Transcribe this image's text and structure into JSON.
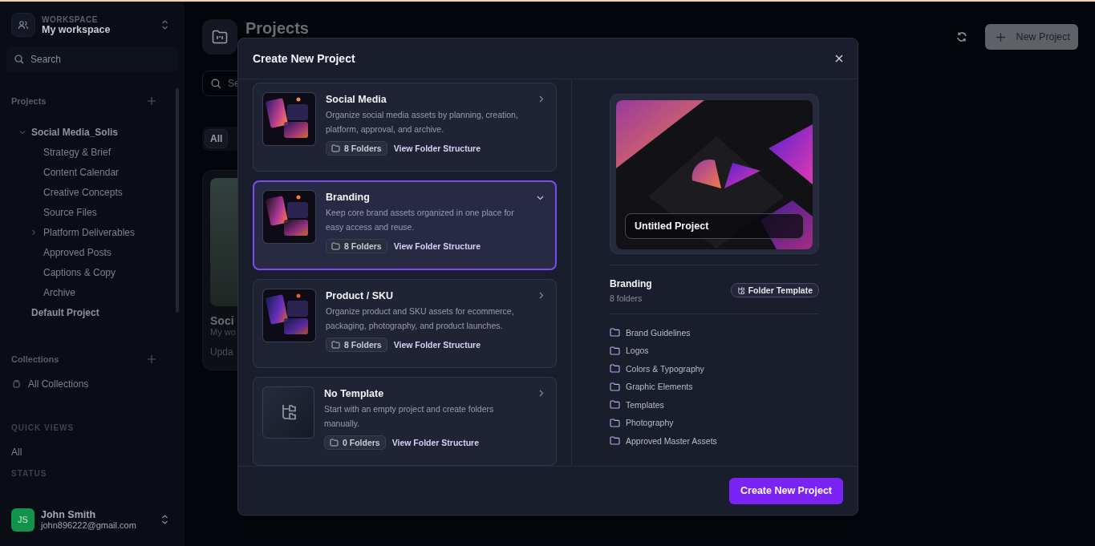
{
  "sidebar": {
    "workspace_label": "WORKSPACE",
    "workspace_name": "My workspace",
    "search": {
      "placeholder": "Search"
    },
    "projects_heading": "Projects",
    "projects": [
      {
        "label": "Social Media_Solis",
        "expanded": true,
        "children": [
          {
            "label": "Strategy & Brief"
          },
          {
            "label": "Content Calendar"
          },
          {
            "label": "Creative Concepts"
          },
          {
            "label": "Source Files"
          },
          {
            "label": "Platform Deliverables",
            "expanded": false
          },
          {
            "label": "Approved Posts"
          },
          {
            "label": "Captions & Copy"
          },
          {
            "label": "Archive"
          }
        ]
      },
      {
        "label": "Default Project"
      }
    ],
    "collections_heading": "Collections",
    "collections": [
      {
        "label": "All Collections"
      }
    ],
    "quick_views_heading": "QUICK VIEWS",
    "quick_views": [
      {
        "label": "All"
      }
    ],
    "status_heading": "STATUS",
    "user": {
      "initials": "JS",
      "name": "John Smith",
      "email": "john896222@gmail.com"
    }
  },
  "page": {
    "title": "Projects",
    "search": {
      "placeholder": "Se"
    },
    "filters": [
      {
        "label": "All",
        "selected": true
      }
    ],
    "new_project_button": "New Project",
    "card": {
      "title": "Soci",
      "subtitle": "My wo",
      "updated": "Upda"
    }
  },
  "dialog": {
    "title": "Create New Project",
    "templates": [
      {
        "kind": "image",
        "name": "Social Media",
        "description": "Organize social media assets by planning, creation, platform, approval, and archive.",
        "folders": "8 Folders",
        "link": "View Folder Structure",
        "selected": false
      },
      {
        "kind": "image",
        "name": "Branding",
        "description": "Keep core brand assets organized in one place for easy access and reuse.",
        "folders": "8 Folders",
        "link": "View Folder Structure",
        "selected": true
      },
      {
        "kind": "image",
        "name": "Product / SKU",
        "description": "Organize product and SKU assets for ecommerce, packaging, photography, and product launches.",
        "folders": "8 Folders",
        "link": "View Folder Structure",
        "selected": false
      },
      {
        "kind": "empty",
        "name": "No Template",
        "description": "Start with an empty project and create folders manually.",
        "folders": "0 Folders",
        "link": "View Folder Structure",
        "selected": false
      }
    ],
    "preview": {
      "project_name": "Untitled Project",
      "template_name": "Branding",
      "folder_count": "8 folders",
      "badge": "Folder Template",
      "folders": [
        "Brand Guidelines",
        "Logos",
        "Colors & Typography",
        "Graphic Elements",
        "Templates",
        "Photography",
        "Approved Master Assets"
      ]
    },
    "primary_button": "Create New Project"
  }
}
